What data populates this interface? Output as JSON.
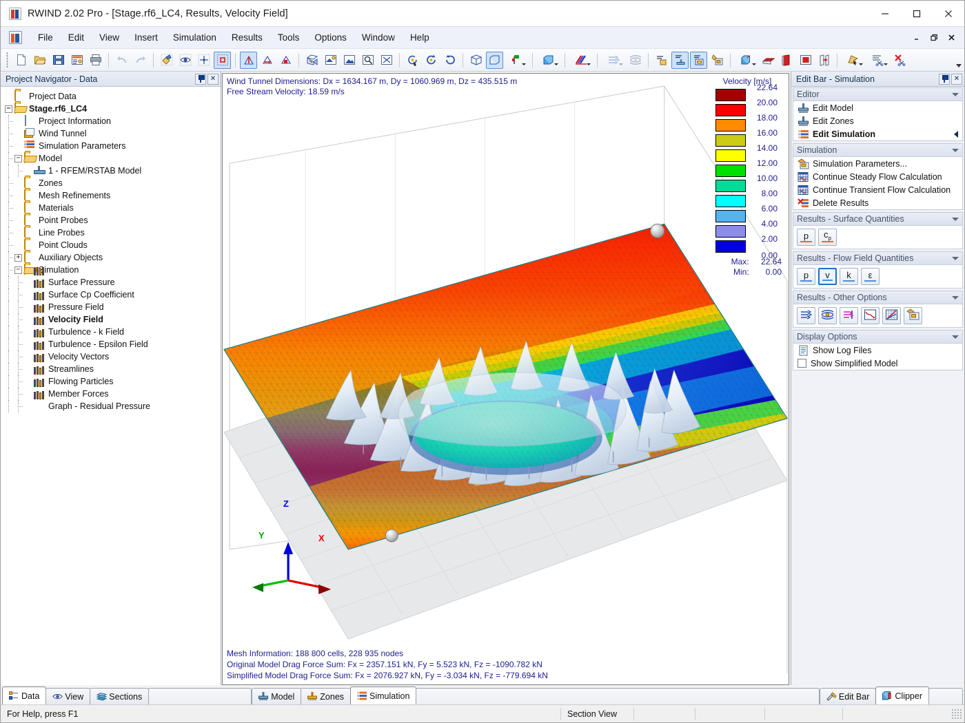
{
  "window": {
    "title": "RWIND 2.02 Pro - [Stage.rf6_LC4, Results, Velocity Field]",
    "app_icon": "rwind-icon",
    "minimize": "—",
    "maximize": "▢",
    "close": "✕"
  },
  "mdi": {
    "minimize": "–",
    "restore": "❐",
    "close": "✕"
  },
  "menu": {
    "items": [
      {
        "label": "File",
        "name": "menu-file"
      },
      {
        "label": "Edit",
        "name": "menu-edit"
      },
      {
        "label": "View",
        "name": "menu-view"
      },
      {
        "label": "Insert",
        "name": "menu-insert"
      },
      {
        "label": "Simulation",
        "name": "menu-simulation"
      },
      {
        "label": "Results",
        "name": "menu-results"
      },
      {
        "label": "Tools",
        "name": "menu-tools"
      },
      {
        "label": "Options",
        "name": "menu-options"
      },
      {
        "label": "Window",
        "name": "menu-window"
      },
      {
        "label": "Help",
        "name": "menu-help"
      }
    ]
  },
  "navigator": {
    "title": "Project Navigator - Data",
    "pin": "pin-icon",
    "close": "✕",
    "tree": [
      {
        "label": "Project Data",
        "icon": "folder",
        "depth": 0,
        "expander": "",
        "bold": false
      },
      {
        "label": "Stage.rf6_LC4",
        "icon": "folder-open",
        "depth": 0,
        "expander": "−",
        "bold": true
      },
      {
        "label": "Project Information",
        "icon": "document",
        "depth": 1,
        "expander": "",
        "bold": false
      },
      {
        "label": "Wind Tunnel",
        "icon": "cube",
        "depth": 1,
        "expander": "",
        "bold": false
      },
      {
        "label": "Simulation Parameters",
        "icon": "sim-params",
        "depth": 1,
        "expander": "",
        "bold": false
      },
      {
        "label": "Model",
        "icon": "folder-open",
        "depth": 1,
        "expander": "−",
        "bold": false
      },
      {
        "label": "1 - RFEM/RSTAB Model",
        "icon": "support",
        "depth": 2,
        "expander": "",
        "bold": false
      },
      {
        "label": "Zones",
        "icon": "folder",
        "depth": 1,
        "expander": "",
        "bold": false
      },
      {
        "label": "Mesh Refinements",
        "icon": "folder",
        "depth": 1,
        "expander": "",
        "bold": false
      },
      {
        "label": "Materials",
        "icon": "folder",
        "depth": 1,
        "expander": "",
        "bold": false
      },
      {
        "label": "Point Probes",
        "icon": "folder",
        "depth": 1,
        "expander": "",
        "bold": false
      },
      {
        "label": "Line Probes",
        "icon": "folder",
        "depth": 1,
        "expander": "",
        "bold": false
      },
      {
        "label": "Point Clouds",
        "icon": "folder",
        "depth": 1,
        "expander": "",
        "bold": false
      },
      {
        "label": "Auxiliary Objects",
        "icon": "folder",
        "depth": 1,
        "expander": "+",
        "bold": false
      },
      {
        "label": "Simulation",
        "icon": "folder-open",
        "depth": 1,
        "expander": "−",
        "bold": false
      },
      {
        "label": "Surface Pressure",
        "icon": "bars",
        "depth": 2,
        "expander": "",
        "bold": false
      },
      {
        "label": "Surface Cp Coefficient",
        "icon": "bars",
        "depth": 2,
        "expander": "",
        "bold": false
      },
      {
        "label": "Pressure Field",
        "icon": "bars",
        "depth": 2,
        "expander": "",
        "bold": false
      },
      {
        "label": "Velocity Field",
        "icon": "bars",
        "depth": 2,
        "expander": "",
        "bold": true
      },
      {
        "label": "Turbulence - k Field",
        "icon": "bars",
        "depth": 2,
        "expander": "",
        "bold": false
      },
      {
        "label": "Turbulence - Epsilon Field",
        "icon": "bars",
        "depth": 2,
        "expander": "",
        "bold": false
      },
      {
        "label": "Velocity Vectors",
        "icon": "bars",
        "depth": 2,
        "expander": "",
        "bold": false
      },
      {
        "label": "Streamlines",
        "icon": "bars",
        "depth": 2,
        "expander": "",
        "bold": false
      },
      {
        "label": "Flowing Particles",
        "icon": "bars",
        "depth": 2,
        "expander": "",
        "bold": false
      },
      {
        "label": "Member Forces",
        "icon": "bars",
        "depth": 2,
        "expander": "",
        "bold": false
      },
      {
        "label": "Graph - Residual Pressure",
        "icon": "bars",
        "depth": 2,
        "expander": "",
        "bold": false
      }
    ]
  },
  "viewport": {
    "info_top_line1": "Wind Tunnel Dimensions: Dx = 1634.167 m, Dy = 1060.969 m, Dz = 435.515 m",
    "info_top_line2": "Free Stream Velocity: 18.59 m/s",
    "info_bottom_line1": "Mesh Information: 188 800 cells, 228 935 nodes",
    "info_bottom_line2": "Original Model Drag Force Sum: Fx = 2357.151 kN, Fy = 5.523 kN, Fz = -1090.782 kN",
    "info_bottom_line3": "Simplified Model Drag Force Sum: Fx = 2076.927 kN, Fy = -3.034 kN, Fz = -779.694 kN",
    "axes": {
      "x": "X",
      "y": "Y",
      "z": "Z",
      "x_color": "#e00000",
      "y_color": "#00c000",
      "z_color": "#0000e0"
    }
  },
  "chart_data": {
    "type": "heatmap",
    "title": "Velocity [m/s]",
    "unit": "m/s",
    "legend_position": "right",
    "colors": [
      "#a30000",
      "#ff0000",
      "#ff8c00",
      "#cccc14",
      "#ffff00",
      "#00e000",
      "#00dc96",
      "#00ffff",
      "#55b4f0",
      "#8c8cf0",
      "#0000dc"
    ],
    "tick_values": [
      "22.64",
      "20.00",
      "18.00",
      "16.00",
      "14.00",
      "12.00",
      "10.00",
      "8.00",
      "6.00",
      "4.00",
      "2.00",
      "0.00"
    ],
    "max_label": "Max:",
    "max_value": "22.64",
    "min_label": "Min:",
    "min_value": "0.00",
    "range": [
      0.0,
      22.64
    ]
  },
  "editbar": {
    "title": "Edit Bar - Simulation",
    "pin": "pin-icon",
    "close": "✕",
    "groups": [
      {
        "name": "editor",
        "title": "Editor",
        "type": "list",
        "items": [
          {
            "label": "Edit Model",
            "icon": "support-icon",
            "bold": false,
            "arrow": false
          },
          {
            "label": "Edit Zones",
            "icon": "support-icon",
            "bold": false,
            "arrow": false
          },
          {
            "label": "Edit Simulation",
            "icon": "sim-params-icon",
            "bold": true,
            "arrow": true
          }
        ]
      },
      {
        "name": "simulation",
        "title": "Simulation",
        "type": "list",
        "items": [
          {
            "label": "Simulation Parameters...",
            "icon": "params-icon",
            "bold": false,
            "arrow": false
          },
          {
            "label": "Continue Steady Flow Calculation",
            "icon": "grid-icon",
            "bold": false,
            "arrow": false
          },
          {
            "label": "Continue Transient Flow Calculation",
            "icon": "grid-icon",
            "bold": false,
            "arrow": false
          },
          {
            "label": "Delete Results",
            "icon": "delete-icon",
            "bold": false,
            "arrow": false
          }
        ]
      },
      {
        "name": "results-surface-quantities",
        "title": "Results - Surface Quantities",
        "type": "buttons",
        "buttons": [
          {
            "label": "p",
            "sub": "",
            "name": "surface-pressure-button",
            "selected": false,
            "bar": "#e07020"
          },
          {
            "label": "c",
            "sub": "p",
            "name": "surface-cp-button",
            "selected": false,
            "bar": "#e07020"
          }
        ]
      },
      {
        "name": "results-flow-field-quantities",
        "title": "Results - Flow Field Quantities",
        "type": "buttons",
        "buttons": [
          {
            "label": "p",
            "sub": "",
            "name": "flow-pressure-button",
            "selected": false,
            "bar": "#4a90d9"
          },
          {
            "label": "v",
            "sub": "",
            "name": "flow-velocity-button",
            "selected": true,
            "bar": "#4a90d9"
          },
          {
            "label": "k",
            "sub": "",
            "name": "flow-k-button",
            "selected": false,
            "bar": "#4a90d9"
          },
          {
            "label": "ε",
            "sub": "",
            "name": "flow-epsilon-button",
            "selected": false,
            "bar": "#4a90d9"
          }
        ]
      },
      {
        "name": "results-other-options",
        "title": "Results - Other Options",
        "type": "icons",
        "icons": [
          {
            "name": "velocity-vectors-icon"
          },
          {
            "name": "streamlines-icon"
          },
          {
            "name": "flowing-particles-icon"
          },
          {
            "name": "residual-graph-icon"
          },
          {
            "name": "member-forces-icon"
          },
          {
            "name": "result-settings-icon"
          }
        ]
      },
      {
        "name": "display-options",
        "title": "Display Options",
        "type": "checklist",
        "items": [
          {
            "label": "Show Log Files",
            "kind": "doc",
            "checked": false
          },
          {
            "label": "Show Simplified Model",
            "kind": "check",
            "checked": false
          }
        ]
      }
    ]
  },
  "bottom_tabs": {
    "left": [
      {
        "label": "Data",
        "name": "tab-data",
        "active": true,
        "icon": "data-icon"
      },
      {
        "label": "View",
        "name": "tab-view",
        "active": false,
        "icon": "eye-icon"
      },
      {
        "label": "Sections",
        "name": "tab-sections",
        "active": false,
        "icon": "sections-icon"
      }
    ],
    "center": [
      {
        "label": "Model",
        "name": "tab-model",
        "active": false,
        "icon": "support-icon"
      },
      {
        "label": "Zones",
        "name": "tab-zones",
        "active": false,
        "icon": "zones-icon"
      },
      {
        "label": "Simulation",
        "name": "tab-simulation",
        "active": true,
        "icon": "sim-icon"
      }
    ],
    "right": [
      {
        "label": "Edit Bar",
        "name": "tab-edit-bar",
        "active": false,
        "icon": "tools-icon"
      },
      {
        "label": "Clipper",
        "name": "tab-clipper",
        "active": true,
        "icon": "clipper-icon"
      }
    ]
  },
  "statusbar": {
    "help_text": "For Help, press F1",
    "section_view": "Section View",
    "cells": [
      "",
      "",
      "",
      ""
    ]
  },
  "toolbar": {
    "groups": [
      {
        "buttons": [
          {
            "name": "new-button",
            "icon": "page"
          },
          {
            "name": "open-button",
            "icon": "folder-open"
          },
          {
            "name": "save-button",
            "icon": "floppy"
          },
          {
            "name": "project-info-button",
            "icon": "form"
          },
          {
            "name": "print-button",
            "icon": "printer"
          }
        ]
      },
      {
        "buttons": [
          {
            "name": "undo-button",
            "icon": "undo",
            "disabled": true
          },
          {
            "name": "redo-button",
            "icon": "redo",
            "disabled": true
          }
        ]
      },
      {
        "buttons": [
          {
            "name": "render-button",
            "icon": "render"
          },
          {
            "name": "visibility-button",
            "icon": "eye-grid"
          },
          {
            "name": "snap-button",
            "icon": "snap"
          },
          {
            "name": "selection-box-button",
            "icon": "select-box",
            "active": true
          }
        ]
      },
      {
        "buttons": [
          {
            "name": "view-iso-button",
            "icon": "axes-iso",
            "active": true
          },
          {
            "name": "view-front-button",
            "icon": "axes-front"
          },
          {
            "name": "view-side-button",
            "icon": "axes-side"
          }
        ]
      },
      {
        "buttons": [
          {
            "name": "wind-direction-button",
            "icon": "wind-cube"
          },
          {
            "name": "shading-button",
            "icon": "shading"
          },
          {
            "name": "zoom-window-button",
            "icon": "zoom-rect"
          },
          {
            "name": "zoom-previous-button",
            "icon": "zoom-lens"
          },
          {
            "name": "zoom-all-button",
            "icon": "zoom-all"
          }
        ]
      },
      {
        "buttons": [
          {
            "name": "rotate-view-button",
            "icon": "rot-cursor"
          },
          {
            "name": "rotate-left-button",
            "icon": "rot-left"
          },
          {
            "name": "rotate-right-button",
            "icon": "rot-right"
          }
        ]
      },
      {
        "buttons": [
          {
            "name": "wireframe-button",
            "icon": "wire-cube"
          },
          {
            "name": "solid-model-button",
            "icon": "solid-cube",
            "active": true
          },
          {
            "name": "model-display-dropdown",
            "icon": "axes-flag",
            "dropdown": true
          }
        ]
      },
      {
        "buttons": [
          {
            "name": "render-mode-dropdown",
            "icon": "blue-cube",
            "dropdown": true
          }
        ]
      },
      {
        "buttons": [
          {
            "name": "results-display-dropdown",
            "icon": "color-stripes",
            "dropdown": true
          }
        ]
      },
      {
        "buttons": [
          {
            "name": "vectors-dropdown",
            "icon": "arrows",
            "dropdown": true,
            "disabled": true
          },
          {
            "name": "streamlines-button",
            "icon": "streamlines",
            "disabled": true
          }
        ]
      },
      {
        "buttons": [
          {
            "name": "particles-button",
            "icon": "particles"
          },
          {
            "name": "result-surface-button",
            "icon": "result-surface",
            "active": true
          },
          {
            "name": "result-field-button",
            "icon": "result-field",
            "active": true
          },
          {
            "name": "result-settings-button",
            "icon": "result-settings"
          }
        ]
      },
      {
        "buttons": [
          {
            "name": "clipper-box-dropdown",
            "icon": "clip-cube",
            "dropdown": true
          },
          {
            "name": "section-plane-xy-button",
            "icon": "plane-xy"
          },
          {
            "name": "section-plane-yz-button",
            "icon": "plane-yz"
          },
          {
            "name": "section-plane-z-button",
            "icon": "plane-z"
          },
          {
            "name": "section-move-button",
            "icon": "plane-move"
          }
        ]
      },
      {
        "buttons": [
          {
            "name": "pick-dropdown",
            "icon": "pick-arrow",
            "dropdown": true
          },
          {
            "name": "cut-dropdown",
            "icon": "scissors-lines",
            "dropdown": true
          },
          {
            "name": "delete-section-button",
            "icon": "scissors-delete"
          }
        ]
      }
    ]
  }
}
